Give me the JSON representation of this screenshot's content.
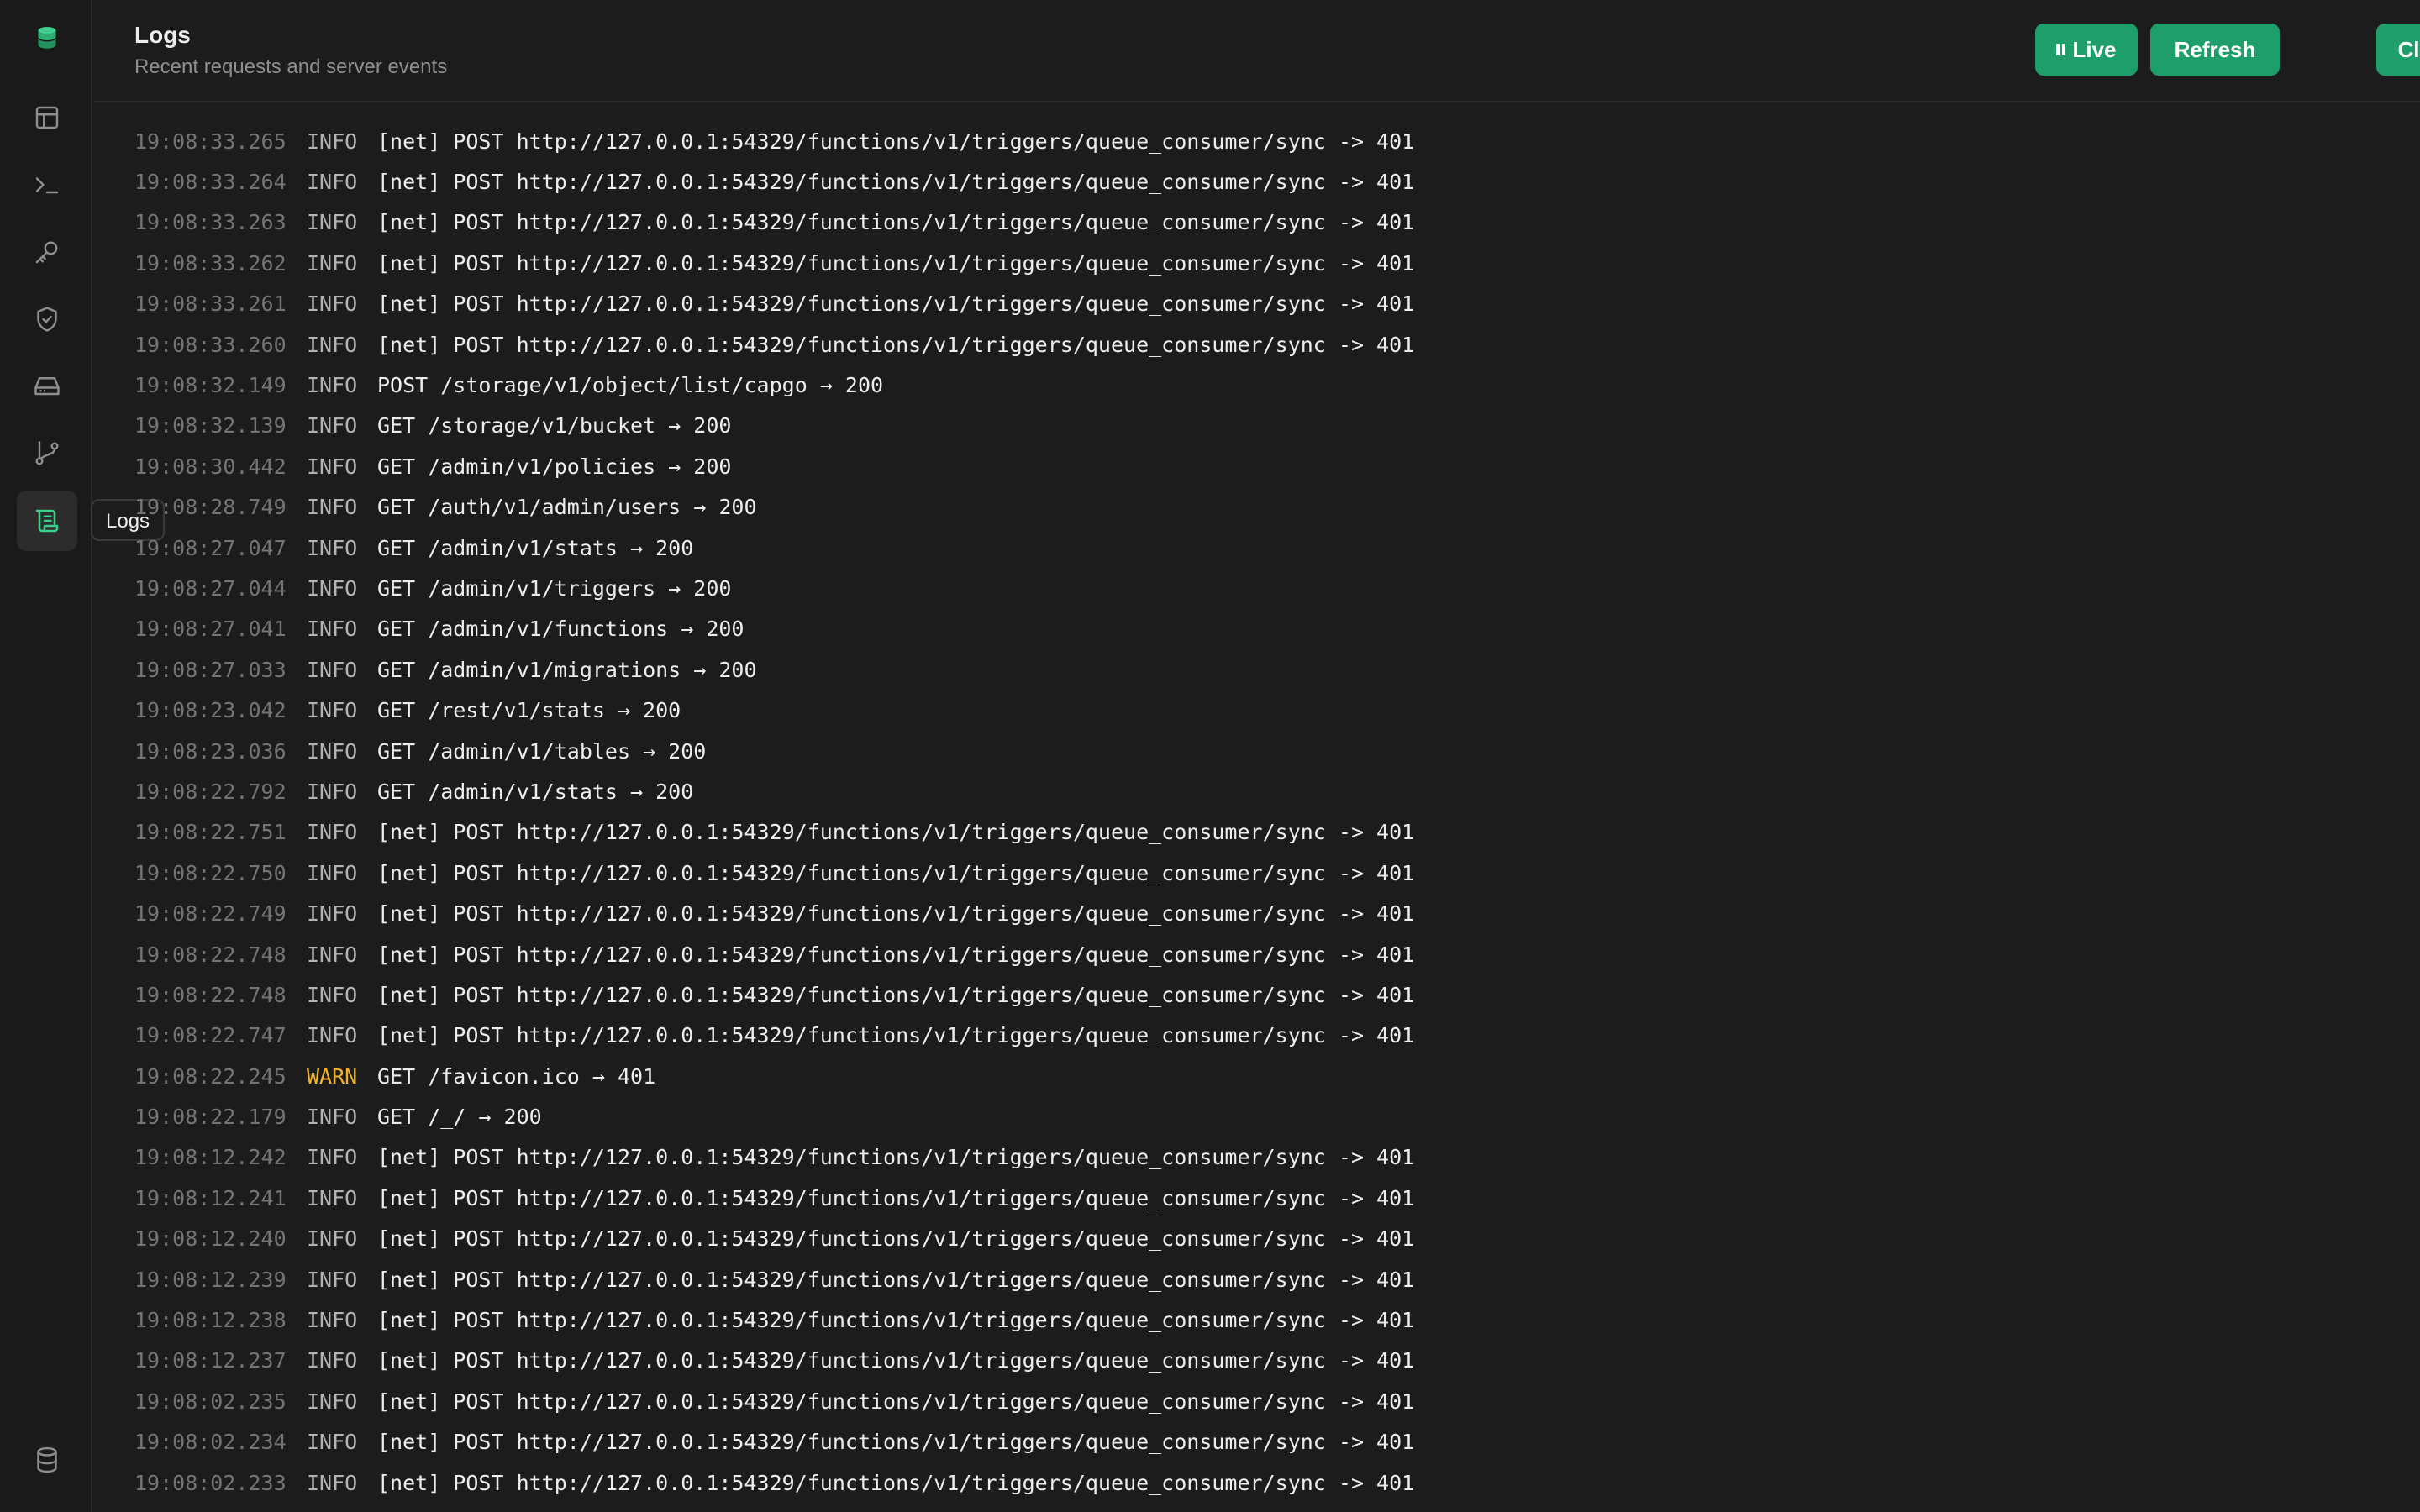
{
  "header": {
    "title": "Logs",
    "subtitle": "Recent requests and server events",
    "buttons": {
      "live": "Live",
      "refresh": "Refresh",
      "clear": "Clear"
    }
  },
  "sidebar": {
    "items": [
      {
        "icon": "database-logo-icon"
      },
      {
        "icon": "table-editor-icon"
      },
      {
        "icon": "sql-terminal-icon"
      },
      {
        "icon": "key-icon"
      },
      {
        "icon": "shield-check-icon"
      },
      {
        "icon": "storage-drive-icon"
      },
      {
        "icon": "git-branch-icon"
      },
      {
        "icon": "logs-scroll-icon",
        "active": true
      }
    ],
    "bottom_icon": "database-icon",
    "tooltip": "Logs"
  },
  "colors": {
    "accent": "#1e9e6a",
    "active_icon": "#3ecf8e",
    "warn": "#f3b42a",
    "background": "#1c1c1c"
  },
  "logs": [
    {
      "time": "19:08:33.265",
      "level": "INFO",
      "message": "[net] POST http://127.0.0.1:54329/functions/v1/triggers/queue_consumer/sync -> 401"
    },
    {
      "time": "19:08:33.264",
      "level": "INFO",
      "message": "[net] POST http://127.0.0.1:54329/functions/v1/triggers/queue_consumer/sync -> 401"
    },
    {
      "time": "19:08:33.263",
      "level": "INFO",
      "message": "[net] POST http://127.0.0.1:54329/functions/v1/triggers/queue_consumer/sync -> 401"
    },
    {
      "time": "19:08:33.262",
      "level": "INFO",
      "message": "[net] POST http://127.0.0.1:54329/functions/v1/triggers/queue_consumer/sync -> 401"
    },
    {
      "time": "19:08:33.261",
      "level": "INFO",
      "message": "[net] POST http://127.0.0.1:54329/functions/v1/triggers/queue_consumer/sync -> 401"
    },
    {
      "time": "19:08:33.260",
      "level": "INFO",
      "message": "[net] POST http://127.0.0.1:54329/functions/v1/triggers/queue_consumer/sync -> 401"
    },
    {
      "time": "19:08:32.149",
      "level": "INFO",
      "message": "POST /storage/v1/object/list/capgo → 200"
    },
    {
      "time": "19:08:32.139",
      "level": "INFO",
      "message": "GET /storage/v1/bucket → 200"
    },
    {
      "time": "19:08:30.442",
      "level": "INFO",
      "message": "GET /admin/v1/policies → 200"
    },
    {
      "time": "19:08:28.749",
      "level": "INFO",
      "message": "GET /auth/v1/admin/users → 200"
    },
    {
      "time": "19:08:27.047",
      "level": "INFO",
      "message": "GET /admin/v1/stats → 200"
    },
    {
      "time": "19:08:27.044",
      "level": "INFO",
      "message": "GET /admin/v1/triggers → 200"
    },
    {
      "time": "19:08:27.041",
      "level": "INFO",
      "message": "GET /admin/v1/functions → 200"
    },
    {
      "time": "19:08:27.033",
      "level": "INFO",
      "message": "GET /admin/v1/migrations → 200"
    },
    {
      "time": "19:08:23.042",
      "level": "INFO",
      "message": "GET /rest/v1/stats → 200"
    },
    {
      "time": "19:08:23.036",
      "level": "INFO",
      "message": "GET /admin/v1/tables → 200"
    },
    {
      "time": "19:08:22.792",
      "level": "INFO",
      "message": "GET /admin/v1/stats → 200"
    },
    {
      "time": "19:08:22.751",
      "level": "INFO",
      "message": "[net] POST http://127.0.0.1:54329/functions/v1/triggers/queue_consumer/sync -> 401"
    },
    {
      "time": "19:08:22.750",
      "level": "INFO",
      "message": "[net] POST http://127.0.0.1:54329/functions/v1/triggers/queue_consumer/sync -> 401"
    },
    {
      "time": "19:08:22.749",
      "level": "INFO",
      "message": "[net] POST http://127.0.0.1:54329/functions/v1/triggers/queue_consumer/sync -> 401"
    },
    {
      "time": "19:08:22.748",
      "level": "INFO",
      "message": "[net] POST http://127.0.0.1:54329/functions/v1/triggers/queue_consumer/sync -> 401"
    },
    {
      "time": "19:08:22.748",
      "level": "INFO",
      "message": "[net] POST http://127.0.0.1:54329/functions/v1/triggers/queue_consumer/sync -> 401"
    },
    {
      "time": "19:08:22.747",
      "level": "INFO",
      "message": "[net] POST http://127.0.0.1:54329/functions/v1/triggers/queue_consumer/sync -> 401"
    },
    {
      "time": "19:08:22.245",
      "level": "WARN",
      "message": "GET /favicon.ico → 401"
    },
    {
      "time": "19:08:22.179",
      "level": "INFO",
      "message": "GET /_/ → 200"
    },
    {
      "time": "19:08:12.242",
      "level": "INFO",
      "message": "[net] POST http://127.0.0.1:54329/functions/v1/triggers/queue_consumer/sync -> 401"
    },
    {
      "time": "19:08:12.241",
      "level": "INFO",
      "message": "[net] POST http://127.0.0.1:54329/functions/v1/triggers/queue_consumer/sync -> 401"
    },
    {
      "time": "19:08:12.240",
      "level": "INFO",
      "message": "[net] POST http://127.0.0.1:54329/functions/v1/triggers/queue_consumer/sync -> 401"
    },
    {
      "time": "19:08:12.239",
      "level": "INFO",
      "message": "[net] POST http://127.0.0.1:54329/functions/v1/triggers/queue_consumer/sync -> 401"
    },
    {
      "time": "19:08:12.238",
      "level": "INFO",
      "message": "[net] POST http://127.0.0.1:54329/functions/v1/triggers/queue_consumer/sync -> 401"
    },
    {
      "time": "19:08:12.237",
      "level": "INFO",
      "message": "[net] POST http://127.0.0.1:54329/functions/v1/triggers/queue_consumer/sync -> 401"
    },
    {
      "time": "19:08:02.235",
      "level": "INFO",
      "message": "[net] POST http://127.0.0.1:54329/functions/v1/triggers/queue_consumer/sync -> 401"
    },
    {
      "time": "19:08:02.234",
      "level": "INFO",
      "message": "[net] POST http://127.0.0.1:54329/functions/v1/triggers/queue_consumer/sync -> 401"
    },
    {
      "time": "19:08:02.233",
      "level": "INFO",
      "message": "[net] POST http://127.0.0.1:54329/functions/v1/triggers/queue_consumer/sync -> 401"
    }
  ]
}
